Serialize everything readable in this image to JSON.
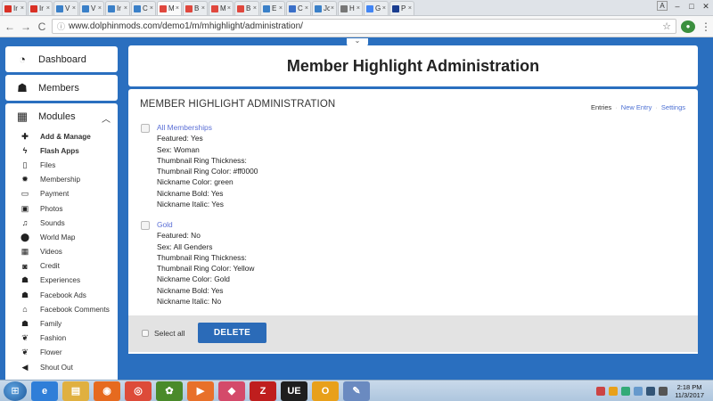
{
  "browser": {
    "tabs": [
      {
        "label": "Ir",
        "color": "#d93025",
        "active": false
      },
      {
        "label": "Ir",
        "color": "#d93025",
        "active": false
      },
      {
        "label": "V",
        "color": "#3a80c8",
        "active": false
      },
      {
        "label": "V",
        "color": "#3a80c8",
        "active": false
      },
      {
        "label": "Ir",
        "color": "#3a80c8",
        "active": false
      },
      {
        "label": "C",
        "color": "#3a80c8",
        "active": false
      },
      {
        "label": "M",
        "color": "#e0473d",
        "active": true
      },
      {
        "label": "B",
        "color": "#e0473d",
        "active": false
      },
      {
        "label": "M",
        "color": "#e0473d",
        "active": false
      },
      {
        "label": "B",
        "color": "#e0473d",
        "active": false
      },
      {
        "label": "E",
        "color": "#3a80c8",
        "active": false
      },
      {
        "label": "C",
        "color": "#3a6fc8",
        "active": false
      },
      {
        "label": "Jc",
        "color": "#3a80c8",
        "active": false
      },
      {
        "label": "H",
        "color": "#777777",
        "active": false
      },
      {
        "label": "G",
        "color": "#4285f4",
        "active": false
      },
      {
        "label": "P",
        "color": "#1a3d8f",
        "active": false
      }
    ],
    "tab_close": "×",
    "window_controls": {
      "profile": "A",
      "minimize": "–",
      "maximize": "□",
      "close": "✕"
    },
    "nav": {
      "back": "←",
      "forward": "→",
      "reload": "C"
    },
    "url": "www.dolphinmods.com/demo1/m/mhighlight/administration/",
    "bookmark_star": "☆",
    "menu": "⋮"
  },
  "sidebar": {
    "dashboard": "Dashboard",
    "members": "Members",
    "modules": "Modules",
    "items": [
      {
        "label": "Add & Manage",
        "icon": "plus-icon",
        "glyph": "✚",
        "bold": true
      },
      {
        "label": "Flash Apps",
        "icon": "bolt-icon",
        "glyph": "ϟ",
        "bold": true
      },
      {
        "label": "Files",
        "icon": "file-icon",
        "glyph": "▯",
        "bold": false
      },
      {
        "label": "Membership",
        "icon": "gear-icon",
        "glyph": "✹",
        "bold": false
      },
      {
        "label": "Payment",
        "icon": "credit-card-icon",
        "glyph": "▭",
        "bold": false
      },
      {
        "label": "Photos",
        "icon": "image-icon",
        "glyph": "▣",
        "bold": false
      },
      {
        "label": "Sounds",
        "icon": "music-icon",
        "glyph": "♫",
        "bold": false
      },
      {
        "label": "World Map",
        "icon": "map-marker-icon",
        "glyph": "⬤",
        "bold": false
      },
      {
        "label": "Videos",
        "icon": "film-icon",
        "glyph": "▦",
        "bold": false
      },
      {
        "label": "Credit",
        "icon": "money-icon",
        "glyph": "◙",
        "bold": false
      },
      {
        "label": "Experiences",
        "icon": "users-icon",
        "glyph": "☗",
        "bold": false
      },
      {
        "label": "Facebook Ads",
        "icon": "users-icon",
        "glyph": "☗",
        "bold": false
      },
      {
        "label": "Facebook Comments",
        "icon": "home-icon",
        "glyph": "⌂",
        "bold": false
      },
      {
        "label": "Family",
        "icon": "users-icon",
        "glyph": "☗",
        "bold": false
      },
      {
        "label": "Fashion",
        "icon": "leaf-icon",
        "glyph": "❦",
        "bold": false
      },
      {
        "label": "Flower",
        "icon": "leaf-icon",
        "glyph": "❦",
        "bold": false
      },
      {
        "label": "Shout Out",
        "icon": "bullhorn-icon",
        "glyph": "◀",
        "bold": false
      }
    ]
  },
  "page": {
    "title": "Member Highlight Administration",
    "panel_heading": "MEMBER HIGHLIGHT ADMINISTRATION",
    "links": {
      "entries": "Entries",
      "new_entry": "New Entry",
      "settings": "Settings"
    },
    "entries": [
      {
        "title": "All Memberships",
        "lines": [
          "Featured: Yes",
          "Sex: Woman",
          "Thumbnail Ring Thickness:",
          "Thumbnail Ring Color: #ff0000",
          "Nickname Color: green",
          "Nickname Bold: Yes",
          "Nickname Italic: Yes"
        ]
      },
      {
        "title": "Gold",
        "lines": [
          "Featured: No",
          "Sex: All Genders",
          "Thumbnail Ring Thickness:",
          "Thumbnail Ring Color: Yellow",
          "Nickname Color: Gold",
          "Nickname Bold: Yes",
          "Nickname Italic: No"
        ]
      }
    ],
    "select_all": "Select all",
    "delete": "DELETE"
  },
  "taskbar": {
    "apps": [
      {
        "icon": "internet-explorer-icon",
        "glyph": "e",
        "color": "#2f7ed8"
      },
      {
        "icon": "file-explorer-icon",
        "glyph": "▤",
        "color": "#e0b040"
      },
      {
        "icon": "firefox-icon",
        "glyph": "◉",
        "color": "#e66a1f"
      },
      {
        "icon": "chrome-icon",
        "glyph": "◎",
        "color": "#dd4b39"
      },
      {
        "icon": "frog-app-icon",
        "glyph": "✿",
        "color": "#4a8a2a"
      },
      {
        "icon": "media-player-icon",
        "glyph": "▶",
        "color": "#e8702a"
      },
      {
        "icon": "eraser-app-icon",
        "glyph": "◆",
        "color": "#d44a6a"
      },
      {
        "icon": "filezilla-icon",
        "glyph": "Z",
        "color": "#bf1e1e"
      },
      {
        "icon": "ue-editor-icon",
        "glyph": "UE",
        "color": "#1e1e1e"
      },
      {
        "icon": "outlook-icon",
        "glyph": "O",
        "color": "#e8a01a"
      },
      {
        "icon": "paint-icon",
        "glyph": "✎",
        "color": "#6a8ac0"
      }
    ],
    "time": "2:18 PM",
    "date": "11/3/2017"
  }
}
